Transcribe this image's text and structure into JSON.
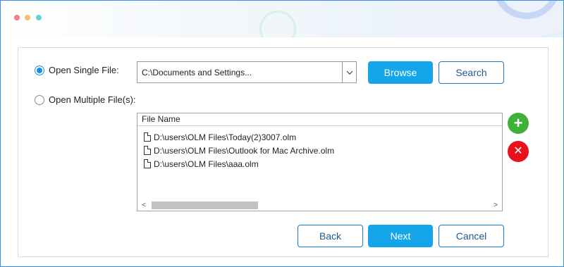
{
  "window": {
    "controls": [
      "close-dot",
      "minimize-dot",
      "maximize-dot"
    ]
  },
  "colors": {
    "accent": "#14a5ea",
    "outline": "#1d76c0",
    "add": "#3fb03a",
    "remove": "#e8121e"
  },
  "options": {
    "single": {
      "label": "Open Single File:",
      "checked": true
    },
    "multiple": {
      "label": "Open Multiple File(s):",
      "checked": false
    }
  },
  "single_file": {
    "path": "C:\\Documents and Settings..."
  },
  "buttons": {
    "browse": "Browse",
    "search": "Search",
    "back": "Back",
    "next": "Next",
    "cancel": "Cancel",
    "add": "+",
    "remove": "✕"
  },
  "file_list": {
    "header": "File Name",
    "items": [
      "D:\\users\\OLM Files\\Today(2)3007.olm",
      "D:\\users\\OLM Files\\Outlook for Mac Archive.olm",
      "D:\\users\\OLM Files\\aaa.olm"
    ]
  },
  "scrollbar": {
    "left_arrow": "<",
    "right_arrow": ">"
  }
}
